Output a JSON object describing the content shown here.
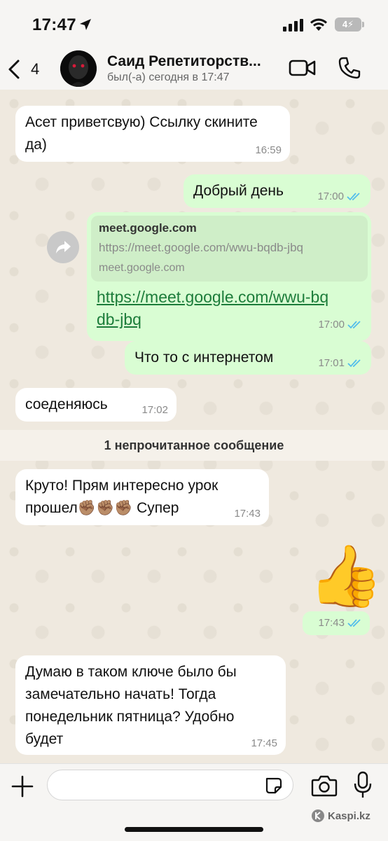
{
  "status_bar": {
    "time": "17:47",
    "battery_level": "4"
  },
  "header": {
    "back_count": "4",
    "contact_name": "Саид Репетиторств...",
    "contact_status": "был(-а) сегодня в 17:47"
  },
  "messages": [
    {
      "direction": "in",
      "text": "Асет приветсвую) Ссылку скините да)",
      "time": "16:59"
    },
    {
      "direction": "out",
      "text": "Добрый день",
      "time": "17:00",
      "read": true
    },
    {
      "direction": "out",
      "type": "link",
      "preview_title": "meet.google.com",
      "preview_url": "https://meet.google.com/wwu-bqdb-jbq",
      "preview_domain": "meet.google.com",
      "text": "https://meet.google.com/wwu-bqdb-jbq",
      "time": "17:00",
      "read": true
    },
    {
      "direction": "out",
      "text": "Что то с интернетом",
      "time": "17:01",
      "read": true
    },
    {
      "direction": "in",
      "text": "соеденяюсь",
      "time": "17:02"
    },
    {
      "direction": "in",
      "text": "Круто! Прям интересно урок прошел✊🏽✊🏽✊🏽 Супер",
      "time": "17:43"
    },
    {
      "direction": "out",
      "type": "emoji",
      "text": "👍",
      "time": "17:43",
      "read": true
    },
    {
      "direction": "in",
      "text": "Думаю в таком ключе было бы замечательно начать! Тогда понедельник пятница? Удобно будет",
      "time": "17:45"
    }
  ],
  "unread_divider": "1 непрочитанное сообщение",
  "input_bar": {
    "placeholder": "",
    "watermark": "Kaspi.kz"
  },
  "colors": {
    "incoming_bubble": "#ffffff",
    "outgoing_bubble": "#d9fdd3",
    "read_check": "#53bdeb",
    "link": "#1c7c3a"
  }
}
